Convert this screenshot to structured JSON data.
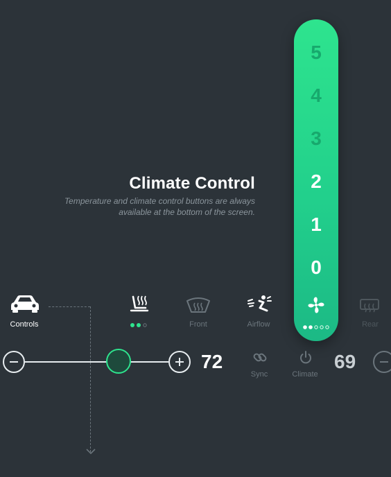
{
  "header": {
    "title": "Climate Control",
    "subtitle": "Temperature and climate control buttons are always available at the bottom of the screen."
  },
  "fan_slider": {
    "levels": [
      "5",
      "4",
      "3",
      "2",
      "1",
      "0"
    ],
    "selected": "2",
    "icon": "fan-icon"
  },
  "controls": {
    "controls_label": "Controls",
    "front_label": "Front",
    "airflow_label": "Airflow",
    "rear_label": "Rear",
    "sync_label": "Sync",
    "climate_label": "Climate"
  },
  "driver": {
    "temperature": "72",
    "level": 0.65
  },
  "passenger": {
    "temperature": "69"
  },
  "colors": {
    "background": "#2c3339",
    "accent": "#2ee48e",
    "muted": "#6b757c"
  }
}
